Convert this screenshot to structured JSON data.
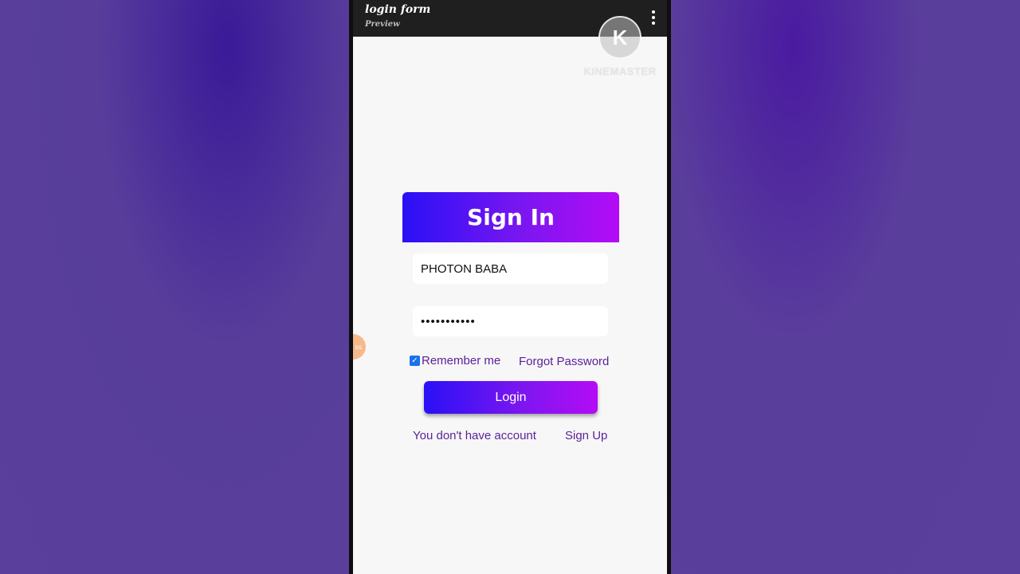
{
  "appbar": {
    "title": "login form",
    "subtitle": "Preview",
    "menu_icon": "more-vert-icon"
  },
  "watermark": {
    "text": "KINEMASTER"
  },
  "form": {
    "title": "Sign In",
    "username_value": "PHOTON BABA",
    "password_value": "•••••••••••",
    "remember_label": "Remember me",
    "remember_checked": true,
    "forgot_label": "Forgot Password",
    "login_label": "Login",
    "no_account_label": "You don't have account",
    "signup_label": "Sign Up"
  },
  "colors": {
    "accent_start": "#2a10f6",
    "accent_end": "#b40cf6",
    "link": "#5a1f9a",
    "appbar": "#1f1f1f",
    "screen_bg": "#f7f7f7"
  }
}
